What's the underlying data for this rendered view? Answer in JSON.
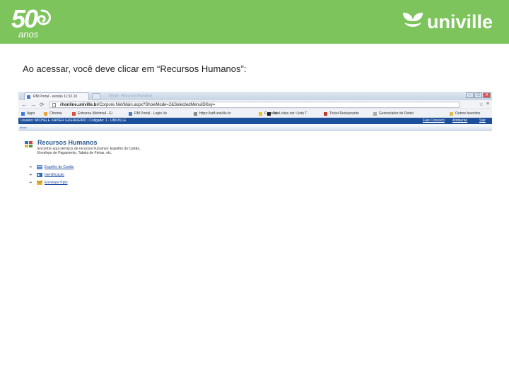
{
  "banner": {
    "anniversary_number": "50",
    "anniversary_word": "anos",
    "brand_name": "univille",
    "color": "#7cc45b"
  },
  "instruction": "Ao acessar, você deve clicar em “Recursos Humanos”:",
  "browser": {
    "tab_title": "RM Portal - versão 11.52.10",
    "ghost_tab_title": "Gmail - Recursos Humanos",
    "window_buttons": [
      "–",
      "□",
      "✕"
    ],
    "nav_buttons": [
      "←",
      "→",
      "⟳"
    ],
    "url_host": "rhonline.univille.br",
    "url_path": "/Corpore.Net/Main.aspx?ShowMode=2&SelectedMenuIDKey=",
    "toolbar_icons": [
      "☆",
      "≡"
    ],
    "bookmarks": [
      {
        "label": "Apps"
      },
      {
        "label": "Chrome"
      },
      {
        "label": "Entrarna Webmail - Ei"
      },
      {
        "label": "RM Portal - Login Ve"
      },
      {
        "label": "https://adf.univille.br"
      },
      {
        "label": "Correios"
      },
      {
        "label": "TeleListas.net: Lista T"
      },
      {
        "label": "Ticket Restaurante"
      },
      {
        "label": "Gerenciador de Roteir"
      },
      {
        "label": "Outros favoritos"
      }
    ]
  },
  "app": {
    "user_line": "Usuário: MICHELE XAVIER GUERREIRO  |  Coligada: 1 - UNIVILLE",
    "contact": "Fale Conosco",
    "environment": "Ambiente",
    "exit": "Sair",
    "breadcrumb": "Início",
    "menu": {
      "title": "Recursos Humanos",
      "description": "Encontre aqui serviços de recursos humanos: Espelho do Cartão, Envelope de Pagamento, Tabela de Férias, etc.",
      "links": [
        {
          "label": "Espelho do Cartão"
        },
        {
          "label": "Identificação"
        },
        {
          "label": "Envelope Pgto"
        }
      ]
    }
  }
}
